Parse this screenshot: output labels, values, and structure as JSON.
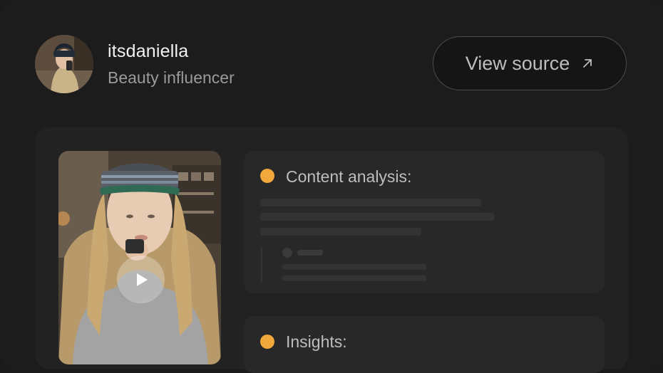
{
  "profile": {
    "username": "itsdaniella",
    "role": "Beauty influencer"
  },
  "actions": {
    "view_source_label": "View source",
    "view_source_icon": "arrow-up-right-icon"
  },
  "video": {
    "play_icon": "play-icon"
  },
  "analysis": {
    "title": "Content analysis:",
    "dot_color": "#F2A93B"
  },
  "insights": {
    "title": "Insights:",
    "dot_color": "#F2A93B"
  }
}
